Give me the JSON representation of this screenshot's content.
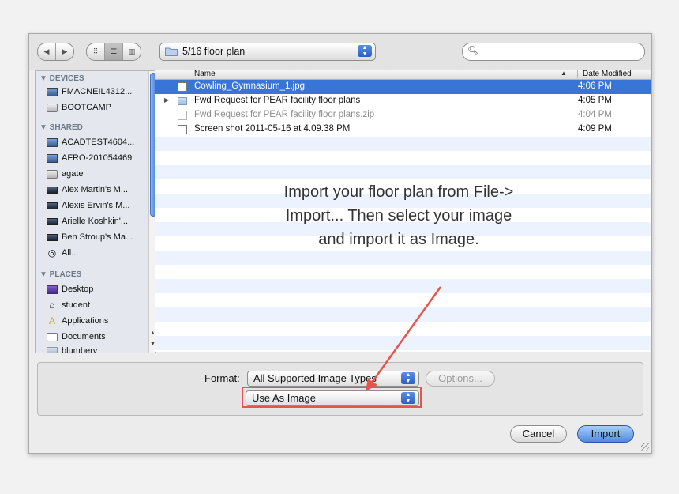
{
  "toolbar": {
    "nav_back": "◀",
    "nav_forward": "▶",
    "view_icon": "⠿",
    "view_list": "☰",
    "view_columns": "▥",
    "path_label": "5/16 floor plan",
    "search_value": ""
  },
  "sidebar": {
    "devices_header": "▼ DEVICES",
    "devices": [
      "FMACNEIL4312...",
      "BOOTCAMP"
    ],
    "shared_header": "▼ SHARED",
    "shared": [
      "ACADTEST4604...",
      "AFRO-201054469",
      "agate",
      "Alex Martin's M...",
      "Alexis Ervin's M...",
      "Arielle Koshkin'...",
      "Ben Stroup's Ma...",
      "All..."
    ],
    "places_header": "▼ PLACES",
    "places": [
      "Desktop",
      "student",
      "Applications",
      "Documents",
      "blumbery"
    ]
  },
  "filelist": {
    "col_name": "Name",
    "col_date": "Date Modified",
    "sort_indicator": "▲",
    "rows": [
      {
        "name": "Cowling_Gymnasium_1.jpg",
        "date": "4:06 PM"
      },
      {
        "name": "Fwd Request for PEAR facility floor plans",
        "date": "4:05 PM"
      },
      {
        "name": "Fwd Request for PEAR facility floor plans.zip",
        "date": "4:04 PM"
      },
      {
        "name": "Screen shot 2011-05-16 at 4.09.38 PM",
        "date": "4:09 PM"
      }
    ]
  },
  "annotation": {
    "line1": "Import your floor plan from File->",
    "line2": "Import... Then select your image",
    "line3": "and import it as Image.",
    "color": "#e4554b"
  },
  "format": {
    "label": "Format:",
    "selected": "All Supported Image Types",
    "options_label": "Options...",
    "use_as": "Use As Image"
  },
  "buttons": {
    "cancel": "Cancel",
    "import": "Import"
  },
  "colors": {
    "selection": "#3875d7",
    "stripe": "#edf3fe",
    "accent_button": "#4f8ae2"
  }
}
